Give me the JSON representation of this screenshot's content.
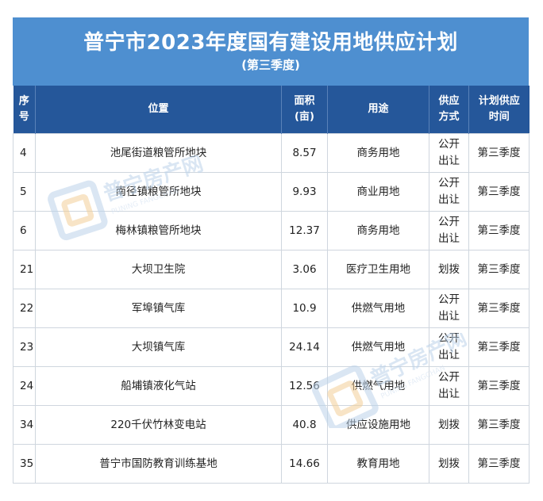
{
  "title": "普宁市2023年度国有建设用地供应计划",
  "subtitle": "(第三季度)",
  "headers": {
    "no": "序号",
    "location": "位置",
    "area": "面积\n(亩)",
    "use": "用途",
    "method": "供应\n方式",
    "time": "计划供应\n时间"
  },
  "rows": [
    {
      "no": "4",
      "location": "池尾街道粮管所地块",
      "area": "8.57",
      "use": "商务用地",
      "method": "公开出让",
      "time": "第三季度"
    },
    {
      "no": "5",
      "location": "南径镇粮管所地块",
      "area": "9.93",
      "use": "商业用地",
      "method": "公开出让",
      "time": "第三季度"
    },
    {
      "no": "6",
      "location": "梅林镇粮管所地块",
      "area": "12.37",
      "use": "商务用地",
      "method": "公开出让",
      "time": "第三季度"
    },
    {
      "no": "21",
      "location": "大坝卫生院",
      "area": "3.06",
      "use": "医疗卫生用地",
      "method": "划拨",
      "time": "第三季度"
    },
    {
      "no": "22",
      "location": "军埠镇气库",
      "area": "10.9",
      "use": "供燃气用地",
      "method": "公开出让",
      "time": "第三季度"
    },
    {
      "no": "23",
      "location": "大坝镇气库",
      "area": "24.14",
      "use": "供燃气用地",
      "method": "公开出让",
      "time": "第三季度"
    },
    {
      "no": "24",
      "location": "船埔镇液化气站",
      "area": "12.56",
      "use": "供燃气用地",
      "method": "公开出让",
      "time": "第三季度"
    },
    {
      "no": "34",
      "location": "220千伏竹林变电站",
      "area": "40.8",
      "use": "供应设施用地",
      "method": "划拨",
      "time": "第三季度"
    },
    {
      "no": "35",
      "location": "普宁市国防教育训练基地",
      "area": "14.66",
      "use": "教育用地",
      "method": "划拨",
      "time": "第三季度"
    }
  ],
  "watermark": {
    "text": "普宁房产网",
    "sub": "PUNING FANGCHAN"
  },
  "colors": {
    "title_bg": "#4e8fd0",
    "header_bg": "#25579a",
    "border": "#cfd6de"
  }
}
